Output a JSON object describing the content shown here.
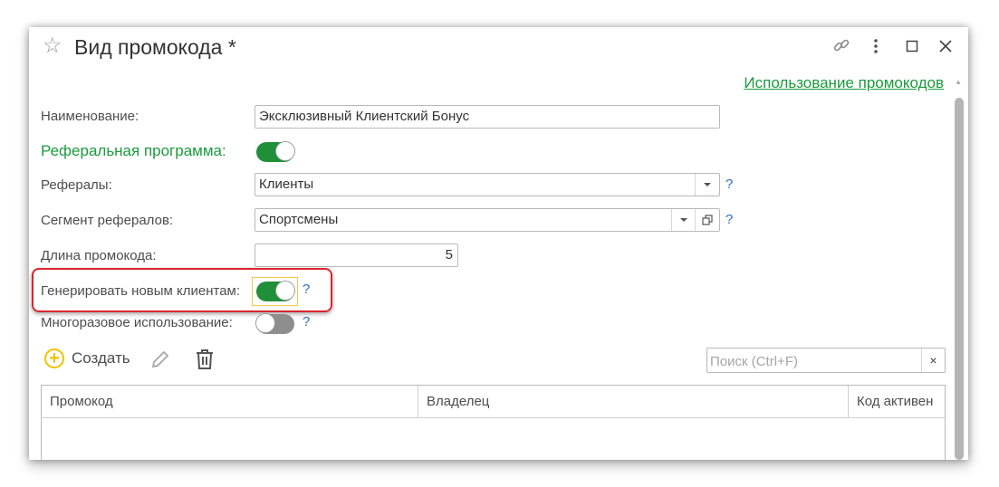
{
  "window": {
    "title": "Вид промокода *",
    "top_link": "Использование промокодов"
  },
  "form": {
    "name_label": "Наименование:",
    "name_value": "Эксклюзивный Клиентский Бонус",
    "referral_program_label": "Реферальная программа:",
    "referral_program_on": true,
    "referrals_label": "Рефералы:",
    "referrals_value": "Клиенты",
    "segment_label": "Сегмент рефералов:",
    "segment_value": "Спортсмены",
    "length_label": "Длина промокода:",
    "length_value": "5",
    "generate_label": "Генерировать новым клиентам:",
    "generate_on": true,
    "reusable_label": "Многоразовое использование:",
    "reusable_on": false,
    "help": "?"
  },
  "toolbar": {
    "create_label": "Создать",
    "search_placeholder": "Поиск (Ctrl+F)",
    "clear_label": "×"
  },
  "table": {
    "columns": [
      "Промокод",
      "Владелец",
      "Код активен"
    ],
    "rows": []
  },
  "icons": {
    "favorite": "star-icon",
    "link": "link-icon",
    "more": "more-vertical-icon",
    "maximize": "maximize-icon",
    "close": "close-icon",
    "create": "plus-circle-icon",
    "edit": "pencil-icon",
    "delete": "trash-icon"
  },
  "colors": {
    "accent_green": "#1a9b3c",
    "toggle_on": "#1f8f3a",
    "help_blue": "#2a6fc9",
    "highlight_red": "#d9262f",
    "create_yellow": "#f2c200"
  }
}
